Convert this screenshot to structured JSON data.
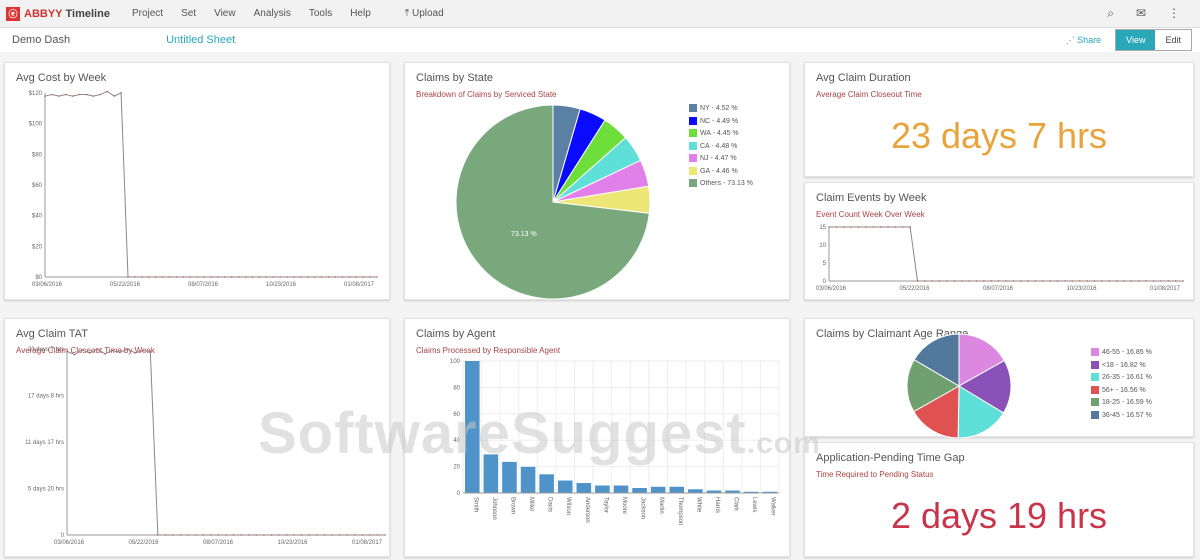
{
  "app": {
    "logo_text_1": "ABBYY",
    "logo_text_2": "Timeline",
    "menu": [
      "Project",
      "Set",
      "View",
      "Analysis",
      "Tools",
      "Help"
    ],
    "upload": "Upload"
  },
  "subbar": {
    "dashboard": "Demo Dash",
    "link": "Untitled Sheet",
    "share": "Share",
    "view": "View",
    "edit": "Edit"
  },
  "cards": {
    "avg_cost": {
      "title": "Avg Cost by Week"
    },
    "claims_state": {
      "title": "Claims by State",
      "subtitle": "Breakdown of Claims by Serviced State"
    },
    "duration": {
      "title": "Avg Claim Duration",
      "subtitle": "Average Claim Closeout Time",
      "value": "23 days 7 hrs",
      "color": "#e8a33a"
    },
    "events": {
      "title": "Claim Events by Week",
      "subtitle": "Event Count Week Over Week"
    },
    "tat": {
      "title": "Avg Claim TAT",
      "subtitle": "Average Claim Closeout Time by Week"
    },
    "agent": {
      "title": "Claims by Agent",
      "subtitle": "Claims Processed by Responsible Agent"
    },
    "age": {
      "title": "Claims by Claimant Age Range"
    },
    "gap": {
      "title": "Application-Pending Time Gap",
      "subtitle": "Time Required to Pending Status",
      "value": "2 days 19 hrs",
      "color": "#c8354a"
    }
  },
  "watermark": "SoftwareSuggest",
  "watermark_suffix": ".com",
  "chart_data": [
    {
      "id": "avg_cost",
      "type": "line",
      "x_ticks": [
        "03/06/2016",
        "05/22/2016",
        "08/07/2016",
        "10/23/2016",
        "01/08/2017"
      ],
      "y_ticks": [
        "$0",
        "$20",
        "$40",
        "$60",
        "$80",
        "$100",
        "$120"
      ],
      "ylim": [
        0,
        120
      ],
      "xlim": [
        0,
        48
      ],
      "values": [
        118,
        119,
        118,
        119,
        118,
        119,
        119,
        118,
        119,
        121,
        118,
        120,
        0,
        0,
        0,
        0,
        0,
        0,
        0,
        0,
        0,
        0,
        0,
        0,
        0,
        0,
        0,
        0,
        0,
        0,
        0,
        0,
        0,
        0,
        0,
        0,
        0,
        0,
        0,
        0,
        0,
        0,
        0,
        0,
        0,
        0,
        0,
        0,
        0
      ]
    },
    {
      "id": "events",
      "type": "line",
      "x_ticks": [
        "03/06/2016",
        "05/22/2016",
        "08/07/2016",
        "10/23/2016",
        "01/08/2017"
      ],
      "y_ticks": [
        "0",
        "5",
        "10",
        "15"
      ],
      "ylim": [
        0,
        16
      ],
      "xlim": [
        0,
        48
      ],
      "values": [
        16,
        16,
        16,
        16,
        16,
        16,
        16,
        16,
        16,
        16,
        16,
        16,
        0,
        0,
        0,
        0,
        0,
        0,
        0,
        0,
        0,
        0,
        0,
        0,
        0,
        0,
        0,
        0,
        0,
        0,
        0,
        0,
        0,
        0,
        0,
        0,
        0,
        0,
        0,
        0,
        0,
        0,
        0,
        0,
        0,
        0,
        0,
        0,
        0
      ]
    },
    {
      "id": "tat",
      "type": "line",
      "x_ticks": [
        "03/06/2016",
        "05/22/2016",
        "08/07/2016",
        "10/23/2016",
        "01/08/2017"
      ],
      "y_ticks": [
        "0",
        "5 days 20 hrs",
        "11 days 17 hrs",
        "17 days 8 hrs",
        "23 days 7 hrs"
      ],
      "ylim": [
        0,
        23.3
      ],
      "xlim": [
        0,
        42
      ],
      "values": [
        23,
        22.6,
        23.2,
        22.8,
        23.3,
        22.7,
        23.1,
        22.9,
        23.3,
        22.8,
        23.1,
        23,
        0,
        0,
        0,
        0,
        0,
        0,
        0,
        0,
        0,
        0,
        0,
        0,
        0,
        0,
        0,
        0,
        0,
        0,
        0,
        0,
        0,
        0,
        0,
        0,
        0,
        0,
        0,
        0,
        0,
        0,
        0
      ]
    },
    {
      "id": "claims_state",
      "type": "pie",
      "labels": [
        "NY",
        "NC",
        "WA",
        "CA",
        "NJ",
        "GA",
        "Others"
      ],
      "values": [
        4.52,
        4.49,
        4.45,
        4.48,
        4.47,
        4.46,
        73.13
      ],
      "colors": [
        "#5a80a4",
        "#0a0aff",
        "#6ede3a",
        "#5ee0d8",
        "#e080e8",
        "#ece676",
        "#78a87c"
      ],
      "slice_label": "73.13 %"
    },
    {
      "id": "age",
      "type": "pie",
      "labels": [
        "46-55",
        "<18",
        "26-35",
        "56+",
        "18-25",
        "36-45"
      ],
      "values": [
        16.85,
        16.82,
        16.61,
        16.56,
        16.59,
        16.57
      ],
      "colors": [
        "#dc88e0",
        "#8a52b8",
        "#5ee0d8",
        "#e05252",
        "#70a070",
        "#52789c"
      ]
    },
    {
      "id": "agent",
      "type": "bar",
      "categories": [
        "Smith",
        "Johnson",
        "Brown",
        "Miller",
        "Davis",
        "Wilson",
        "Anderson",
        "Taylor",
        "Moore",
        "Jackson",
        "Martin",
        "Thompson",
        "White",
        "Harris",
        "Clark",
        "Lewis",
        "Walker"
      ],
      "values": [
        106,
        31,
        25,
        21,
        15,
        10,
        8,
        6,
        6,
        4,
        5,
        5,
        3,
        2,
        2,
        1,
        1
      ],
      "y_ticks": [
        "0",
        "20",
        "40",
        "60",
        "80",
        "100"
      ],
      "ylim": [
        0,
        106
      ],
      "color": "#4f93c8"
    }
  ]
}
